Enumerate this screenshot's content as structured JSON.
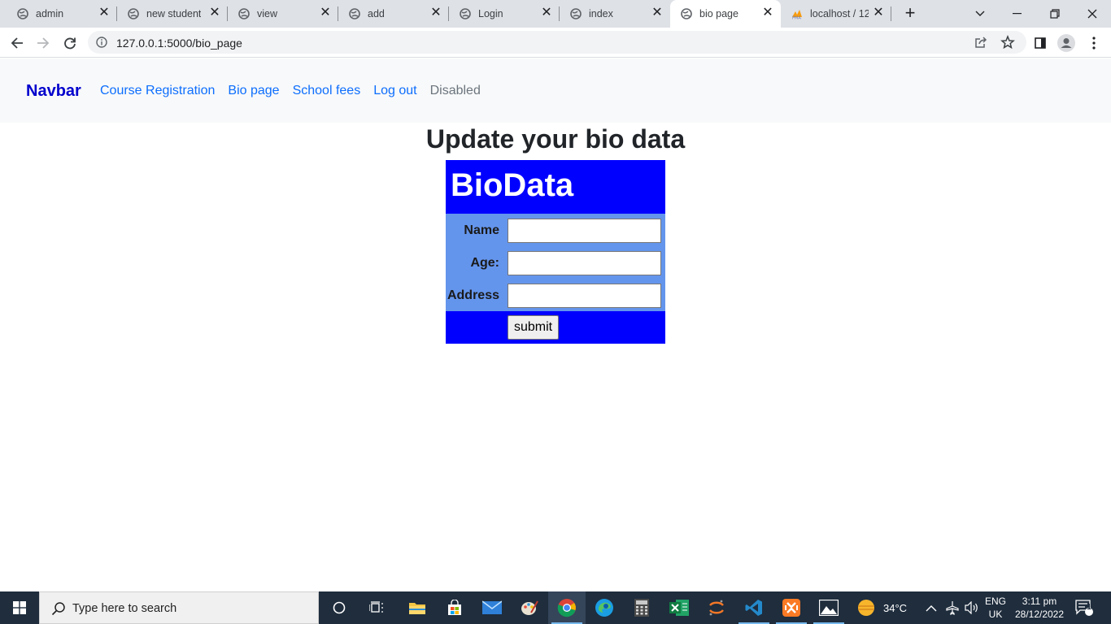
{
  "browser": {
    "tabs": [
      {
        "title": "admin"
      },
      {
        "title": "new student"
      },
      {
        "title": "view"
      },
      {
        "title": "add"
      },
      {
        "title": "Login"
      },
      {
        "title": "index"
      },
      {
        "title": "bio page",
        "active": true
      },
      {
        "title": "localhost / 12"
      }
    ],
    "url": "127.0.0.1:5000/bio_page"
  },
  "navbar": {
    "brand": "Navbar",
    "links": [
      "Course Registration",
      "Bio page",
      "School fees",
      "Log out",
      "Disabled"
    ]
  },
  "page": {
    "heading": "Update your bio data"
  },
  "form": {
    "title": "BioData",
    "fields": [
      {
        "label": "Name",
        "value": ""
      },
      {
        "label": "Age:",
        "value": ""
      },
      {
        "label": "Address",
        "value": ""
      }
    ],
    "submit_label": "submit",
    "colors": {
      "header_bg": "#0000ff",
      "body_bg": "#6495ed",
      "title_color": "#ffffff"
    }
  },
  "taskbar": {
    "search_placeholder": "Type here to search",
    "weather": "34°C",
    "lang_line1": "ENG",
    "lang_line2": "UK",
    "time": "3:11 pm",
    "date": "28/12/2022",
    "notification_count": "1"
  }
}
